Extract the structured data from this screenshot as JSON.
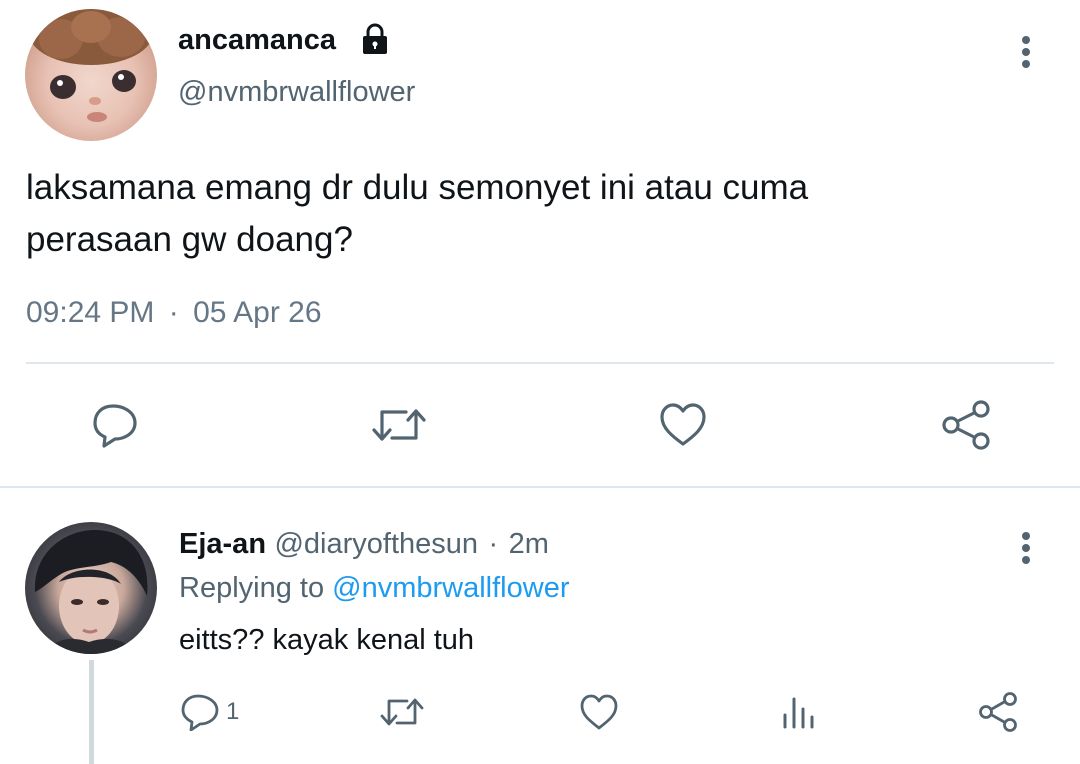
{
  "tweet": {
    "author": {
      "display_name": "ancamanca",
      "handle": "@nvmbrwallflower",
      "locked": true
    },
    "text_line1": "laksamana emang dr dulu semonyet ini atau cuma",
    "text_line2": "perasaan gw doang?",
    "time": "09:24 PM",
    "separator": "·",
    "date": "05 Apr 26",
    "actions": [
      "comment-icon",
      "retweet-icon",
      "heart-icon",
      "share-icon"
    ]
  },
  "reply": {
    "display_name": "Eja-an",
    "handle": "@diaryofthesun",
    "dot": "·",
    "age": "2m",
    "replying_prefix": "Replying to",
    "replying_to": "@nvmbrwallflower",
    "text": "eitts?? kayak kenal tuh",
    "comment_count": "1",
    "actions": [
      "comment-icon",
      "retweet-icon",
      "heart-icon",
      "analytics-icon",
      "share-icon"
    ]
  },
  "colors": {
    "text_primary": "#0f1419",
    "text_secondary": "#536471",
    "link": "#1d9bf0",
    "icon": "#536471",
    "divider": "#e1e8ed"
  }
}
